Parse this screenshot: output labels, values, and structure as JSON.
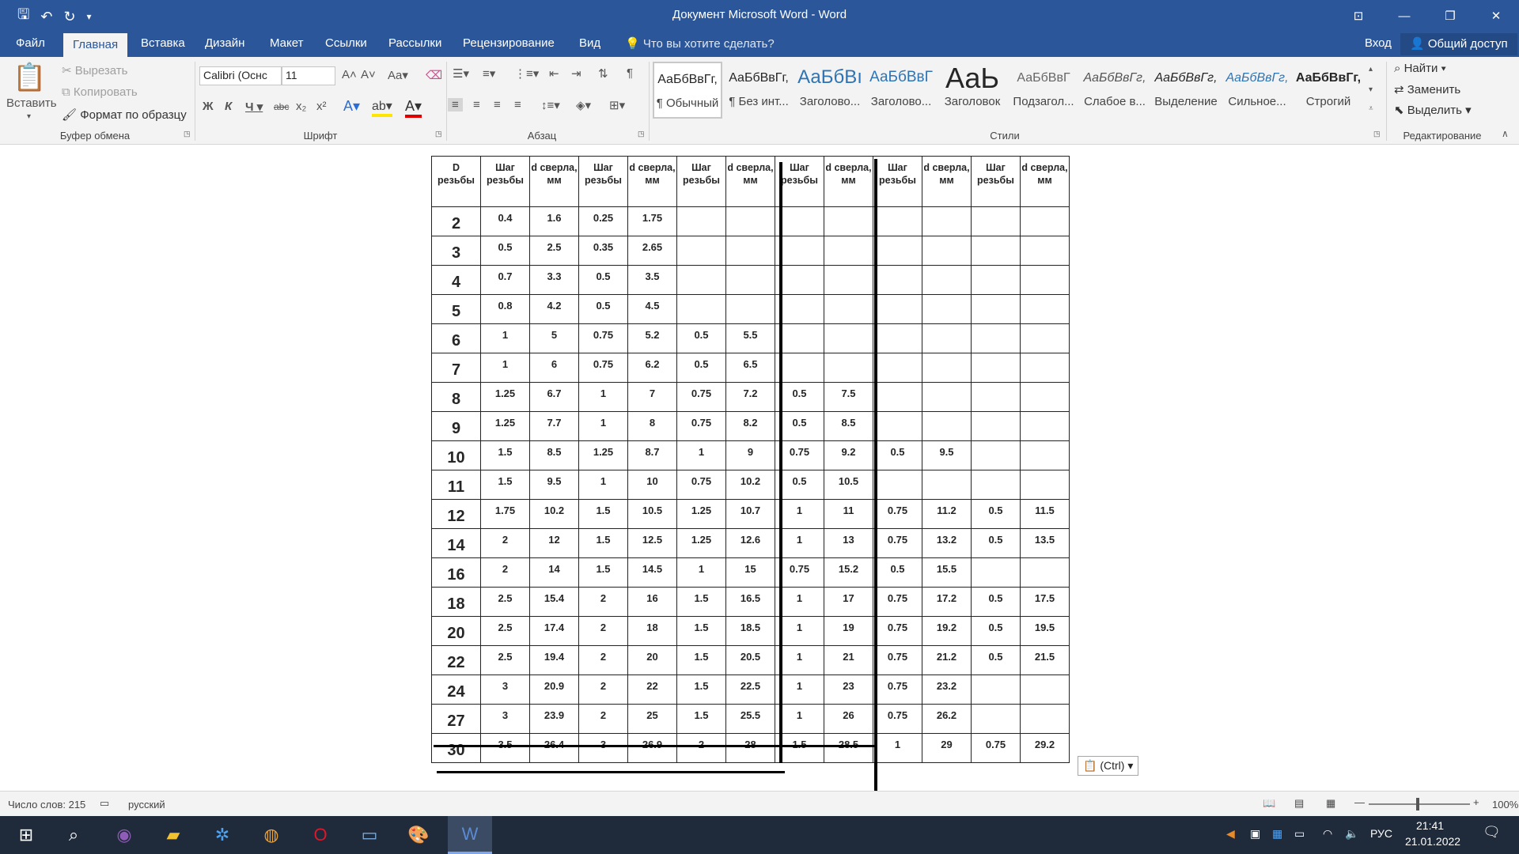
{
  "window": {
    "title": "Документ Microsoft Word - Word",
    "qat": {
      "save_icon": "save-icon",
      "undo_icon": "undo-icon",
      "redo_icon": "redo-icon"
    }
  },
  "tabs": [
    "Файл",
    "Главная",
    "Вставка",
    "Дизайн",
    "Макет",
    "Ссылки",
    "Рассылки",
    "Рецензирование",
    "Вид"
  ],
  "active_tab": "Главная",
  "tell_me": "Что вы хотите сделать?",
  "signin": "Вход",
  "share": "Общий доступ",
  "ribbon": {
    "clipboard": {
      "paste": "Вставить",
      "cut": "Вырезать",
      "copy": "Копировать",
      "format_painter": "Формат по образцу",
      "label": "Буфер обмена"
    },
    "font": {
      "name": "Calibri (Оснс",
      "size": "11",
      "label": "Шрифт"
    },
    "paragraph": {
      "label": "Абзац"
    },
    "styles": {
      "label": "Стили",
      "items": [
        {
          "sample": "АаБбВвГг,",
          "name": "¶ Обычный"
        },
        {
          "sample": "АаБбВвГг,",
          "name": "¶ Без инт..."
        },
        {
          "sample": "АаБбВı",
          "name": "Заголово..."
        },
        {
          "sample": "АаБбВвГ",
          "name": "Заголово..."
        },
        {
          "sample": "АаЬ",
          "name": "Заголовок"
        },
        {
          "sample": "АаБбВвГ",
          "name": "Подзагол..."
        },
        {
          "sample": "АаБбВвГг,",
          "name": "Слабое в..."
        },
        {
          "sample": "АаБбВвГг,",
          "name": "Выделение"
        },
        {
          "sample": "АаБбВвГг,",
          "name": "Сильное..."
        },
        {
          "sample": "АаБбВвГг,",
          "name": "Строгий"
        }
      ]
    },
    "editing": {
      "find": "Найти",
      "replace": "Заменить",
      "select": "Выделить",
      "label": "Редактирование"
    }
  },
  "table": {
    "headers": [
      "D резьбы",
      "Шаг резьбы",
      "d сверла, мм",
      "Шаг резьбы",
      "d сверла, мм",
      "Шаг резьбы",
      "d сверла, мм",
      "Шаг резьбы",
      "d сверла, мм",
      "Шаг резьбы",
      "d сверла, мм",
      "Шаг резьбы",
      "d сверла, мм"
    ],
    "rows": [
      [
        "2",
        "0.4",
        "1.6",
        "0.25",
        "1.75",
        "",
        "",
        "",
        "",
        "",
        "",
        "",
        ""
      ],
      [
        "3",
        "0.5",
        "2.5",
        "0.35",
        "2.65",
        "",
        "",
        "",
        "",
        "",
        "",
        "",
        ""
      ],
      [
        "4",
        "0.7",
        "3.3",
        "0.5",
        "3.5",
        "",
        "",
        "",
        "",
        "",
        "",
        "",
        ""
      ],
      [
        "5",
        "0.8",
        "4.2",
        "0.5",
        "4.5",
        "",
        "",
        "",
        "",
        "",
        "",
        "",
        ""
      ],
      [
        "6",
        "1",
        "5",
        "0.75",
        "5.2",
        "0.5",
        "5.5",
        "",
        "",
        "",
        "",
        "",
        ""
      ],
      [
        "7",
        "1",
        "6",
        "0.75",
        "6.2",
        "0.5",
        "6.5",
        "",
        "",
        "",
        "",
        "",
        ""
      ],
      [
        "8",
        "1.25",
        "6.7",
        "1",
        "7",
        "0.75",
        "7.2",
        "0.5",
        "7.5",
        "",
        "",
        "",
        ""
      ],
      [
        "9",
        "1.25",
        "7.7",
        "1",
        "8",
        "0.75",
        "8.2",
        "0.5",
        "8.5",
        "",
        "",
        "",
        ""
      ],
      [
        "10",
        "1.5",
        "8.5",
        "1.25",
        "8.7",
        "1",
        "9",
        "0.75",
        "9.2",
        "0.5",
        "9.5",
        "",
        ""
      ],
      [
        "11",
        "1.5",
        "9.5",
        "1",
        "10",
        "0.75",
        "10.2",
        "0.5",
        "10.5",
        "",
        "",
        "",
        ""
      ],
      [
        "12",
        "1.75",
        "10.2",
        "1.5",
        "10.5",
        "1.25",
        "10.7",
        "1",
        "11",
        "0.75",
        "11.2",
        "0.5",
        "11.5"
      ],
      [
        "14",
        "2",
        "12",
        "1.5",
        "12.5",
        "1.25",
        "12.6",
        "1",
        "13",
        "0.75",
        "13.2",
        "0.5",
        "13.5"
      ],
      [
        "16",
        "2",
        "14",
        "1.5",
        "14.5",
        "1",
        "15",
        "0.75",
        "15.2",
        "0.5",
        "15.5",
        "",
        ""
      ],
      [
        "18",
        "2.5",
        "15.4",
        "2",
        "16",
        "1.5",
        "16.5",
        "1",
        "17",
        "0.75",
        "17.2",
        "0.5",
        "17.5"
      ],
      [
        "20",
        "2.5",
        "17.4",
        "2",
        "18",
        "1.5",
        "18.5",
        "1",
        "19",
        "0.75",
        "19.2",
        "0.5",
        "19.5"
      ],
      [
        "22",
        "2.5",
        "19.4",
        "2",
        "20",
        "1.5",
        "20.5",
        "1",
        "21",
        "0.75",
        "21.2",
        "0.5",
        "21.5"
      ],
      [
        "24",
        "3",
        "20.9",
        "2",
        "22",
        "1.5",
        "22.5",
        "1",
        "23",
        "0.75",
        "23.2",
        "",
        ""
      ],
      [
        "27",
        "3",
        "23.9",
        "2",
        "25",
        "1.5",
        "25.5",
        "1",
        "26",
        "0.75",
        "26.2",
        "",
        ""
      ],
      [
        "30",
        "3.5",
        "26.4",
        "3",
        "26.9",
        "2",
        "28",
        "1.5",
        "28.5",
        "1",
        "29",
        "0.75",
        "29.2"
      ]
    ]
  },
  "paste_options": "(Ctrl)",
  "status": {
    "words": "Число слов: 215",
    "language": "русский",
    "zoom": "100%"
  },
  "taskbar": {
    "lang": "РУС",
    "time": "21:41",
    "date": "21.01.2022"
  },
  "colors": {
    "accent": "#2b579a"
  }
}
